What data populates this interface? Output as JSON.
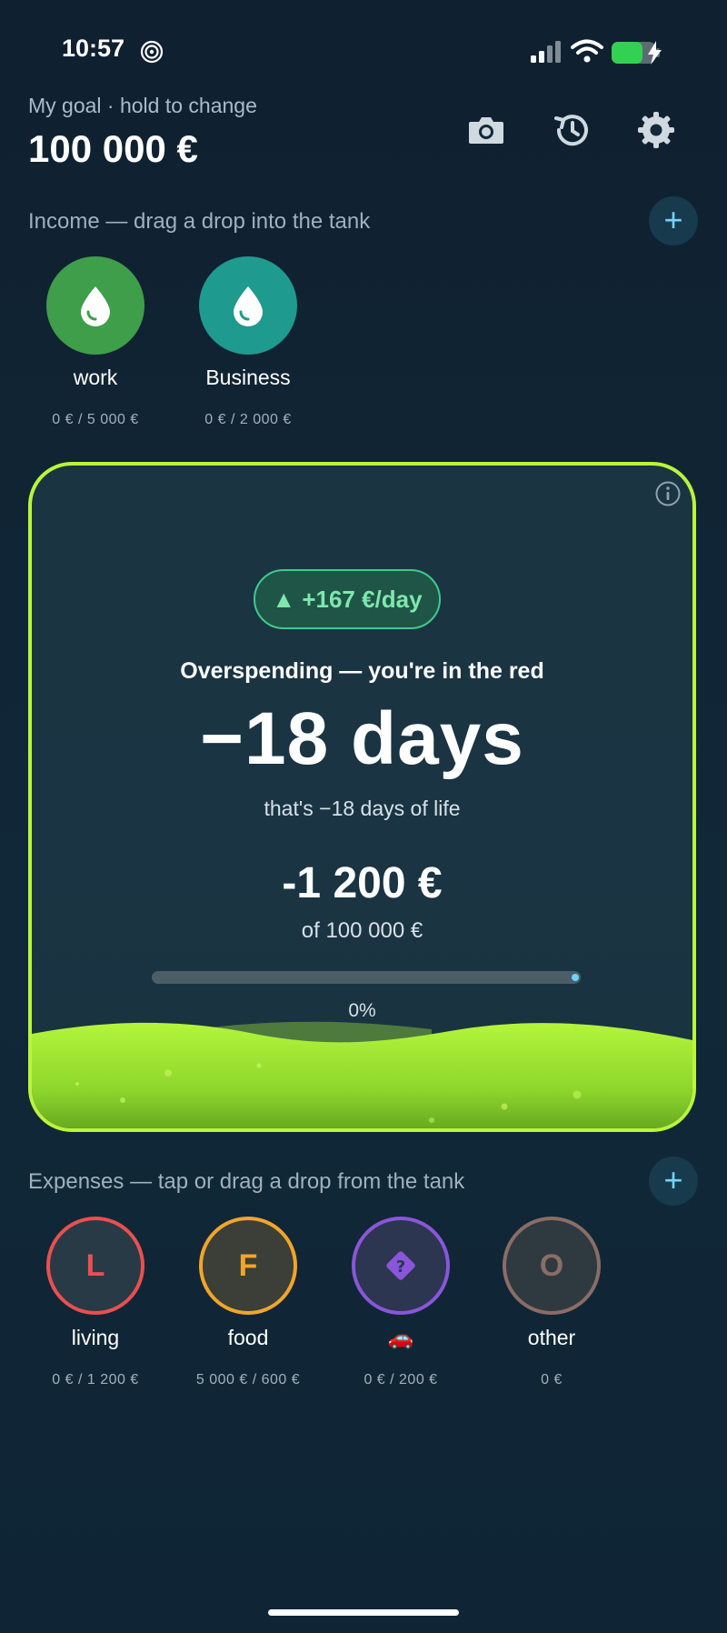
{
  "status_bar": {
    "time": "10:57"
  },
  "header": {
    "goal_label": "My goal · hold to change",
    "goal_value": "100 000 €",
    "icons": [
      "camera-icon",
      "history-icon",
      "gear-icon"
    ]
  },
  "income": {
    "label": "Income — drag a drop into the tank",
    "add_label": "+",
    "items": [
      {
        "name": "work",
        "amount": "0 € / 5 000 €",
        "color": "#3f9e4a",
        "icon": "drop-icon"
      },
      {
        "name": "Business",
        "amount": "0 € / 2 000 €",
        "color": "#1f9a8e",
        "icon": "drop-icon"
      }
    ]
  },
  "tank": {
    "rate": "▲ +167 €/day",
    "status": "Overspending — you're in the red",
    "days": "−18 days",
    "days_sub": "that's −18 days of life",
    "balance": "-1 200 €",
    "of_goal": "of 100 000 €",
    "progress": 0,
    "progress_label": "0%",
    "accent": "#b8f53c"
  },
  "expenses": {
    "label": "Expenses — tap or drag a drop from the tank",
    "add_label": "+",
    "items": [
      {
        "letter": "L",
        "name": "living",
        "amount": "0 € / 1 200 €",
        "color": "#e8504f"
      },
      {
        "letter": "F",
        "name": "food",
        "amount": "5 000 € / 600 €",
        "color": "#f2a52a"
      },
      {
        "letter": "?",
        "name": "🚗",
        "amount": "0 € / 200 €",
        "color": "#8a56d9"
      },
      {
        "letter": "O",
        "name": "other",
        "amount": "0 €",
        "color": "#8a6d66"
      }
    ]
  }
}
